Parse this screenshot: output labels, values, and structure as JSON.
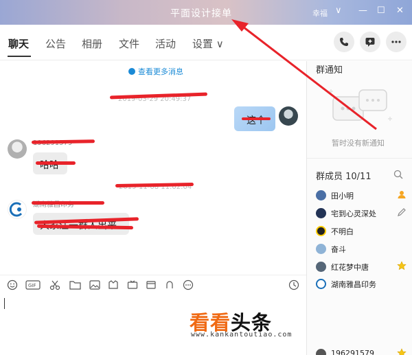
{
  "window": {
    "title": "平面设计接单",
    "skin_label": "幸福",
    "controls": [
      "∨",
      "—",
      "☐",
      "✕"
    ]
  },
  "tabs": [
    {
      "label": "聊天"
    },
    {
      "label": "公告"
    },
    {
      "label": "相册"
    },
    {
      "label": "文件"
    },
    {
      "label": "活动"
    },
    {
      "label": "设置 ∨"
    }
  ],
  "chat": {
    "more_messages": "查看更多消息",
    "timestamp_1": "2019-03-29 20:49:37",
    "my_message": "这个",
    "sender_1": "196291579",
    "message_1": "哈哈",
    "timestamp_2": "2019-11-08 11:02:04",
    "sender_2": "湖南雅昌印务",
    "message_2": "大家注一群人出来"
  },
  "group_notice": {
    "title": "群通知",
    "empty_text": "暂时没有新通知"
  },
  "members": {
    "title": "群成员 10/11",
    "list": [
      {
        "name": "田小明",
        "color": "#4a6fa5",
        "badge": "person"
      },
      {
        "name": "宅到心灵深处",
        "color": "#223355",
        "badge": "edit"
      },
      {
        "name": "不明白",
        "color": "#ffcc00",
        "badge": ""
      },
      {
        "name": "奋斗",
        "color": "#8fb3d6",
        "badge": ""
      },
      {
        "name": "红花梦中唐",
        "color": "#556677",
        "badge": "star"
      },
      {
        "name": "湖南雅昌印务",
        "color": "#1a6fb8",
        "badge": ""
      },
      {
        "name": "196291579",
        "color": "#555555",
        "badge": "star"
      }
    ]
  },
  "watermark": {
    "big_a": "看看",
    "big_b": "头条",
    "url": "www.kankantoutiao.com"
  },
  "colors": {
    "accent_blue": "#1a8ad6",
    "redline": "#e8232a",
    "watermark_orange": "#f06a14"
  }
}
